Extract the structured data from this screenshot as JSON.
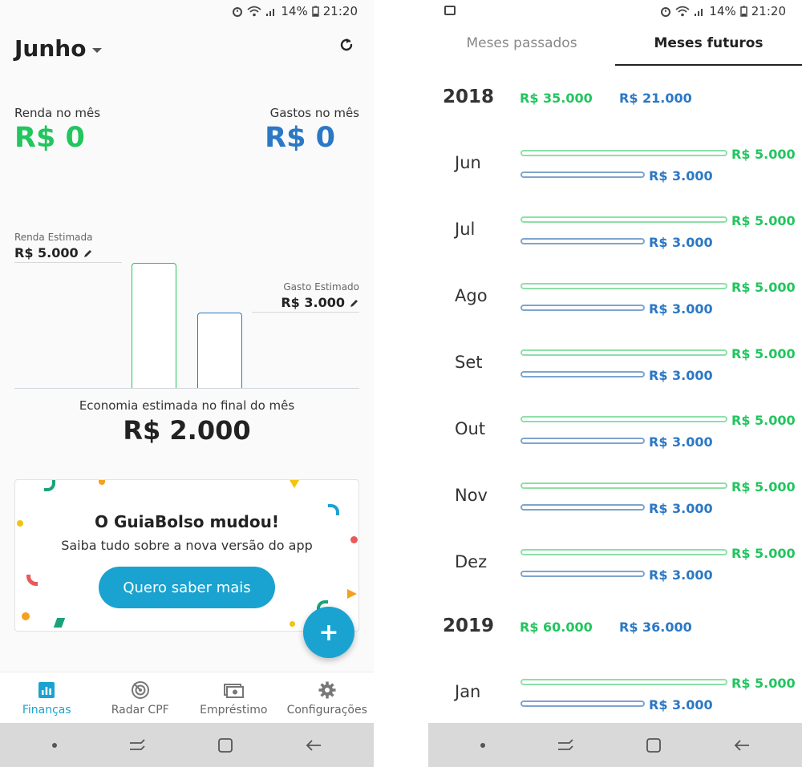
{
  "status_bar": {
    "battery": "14%",
    "time": "21:20"
  },
  "left": {
    "month": "Junho",
    "income_label": "Renda no mês",
    "income_value": "R$ 0",
    "expense_label": "Gastos no mês",
    "expense_value": "R$ 0",
    "est_income_label": "Renda Estimada",
    "est_income_value": "R$ 5.000",
    "est_expense_label": "Gasto Estimado",
    "est_expense_value": "R$ 3.000",
    "savings_label": "Economia estimada no final do mês",
    "savings_value": "R$ 2.000",
    "promo_title": "O GuiaBolso mudou!",
    "promo_subtitle": "Saiba tudo sobre a nova versão do app",
    "promo_button": "Quero saber mais",
    "fab_label": "+",
    "nav": [
      {
        "label": "Finanças",
        "icon": "chart-icon",
        "active": true
      },
      {
        "label": "Radar CPF",
        "icon": "radar-icon",
        "active": false
      },
      {
        "label": "Empréstimo",
        "icon": "money-icon",
        "active": false
      },
      {
        "label": "Configurações",
        "icon": "gear-icon",
        "active": false
      }
    ]
  },
  "right": {
    "tabs": [
      "Meses passados",
      "Meses futuros"
    ],
    "active_tab": 1,
    "years": [
      {
        "year": "2018",
        "income": "R$ 35.000",
        "expense": "R$ 21.000",
        "months": [
          {
            "name": "Jun",
            "income": "R$ 5.000",
            "expense": "R$ 3.000"
          },
          {
            "name": "Jul",
            "income": "R$ 5.000",
            "expense": "R$ 3.000"
          },
          {
            "name": "Ago",
            "income": "R$ 5.000",
            "expense": "R$ 3.000"
          },
          {
            "name": "Set",
            "income": "R$ 5.000",
            "expense": "R$ 3.000"
          },
          {
            "name": "Out",
            "income": "R$ 5.000",
            "expense": "R$ 3.000"
          },
          {
            "name": "Nov",
            "income": "R$ 5.000",
            "expense": "R$ 3.000"
          },
          {
            "name": "Dez",
            "income": "R$ 5.000",
            "expense": "R$ 3.000"
          }
        ]
      },
      {
        "year": "2019",
        "income": "R$ 60.000",
        "expense": "R$ 36.000",
        "months": [
          {
            "name": "Jan",
            "income": "R$ 5.000",
            "expense": "R$ 3.000"
          }
        ]
      }
    ]
  },
  "colors": {
    "income": "#22c55e",
    "expense": "#2b78c5",
    "accent": "#1aa3d0"
  }
}
